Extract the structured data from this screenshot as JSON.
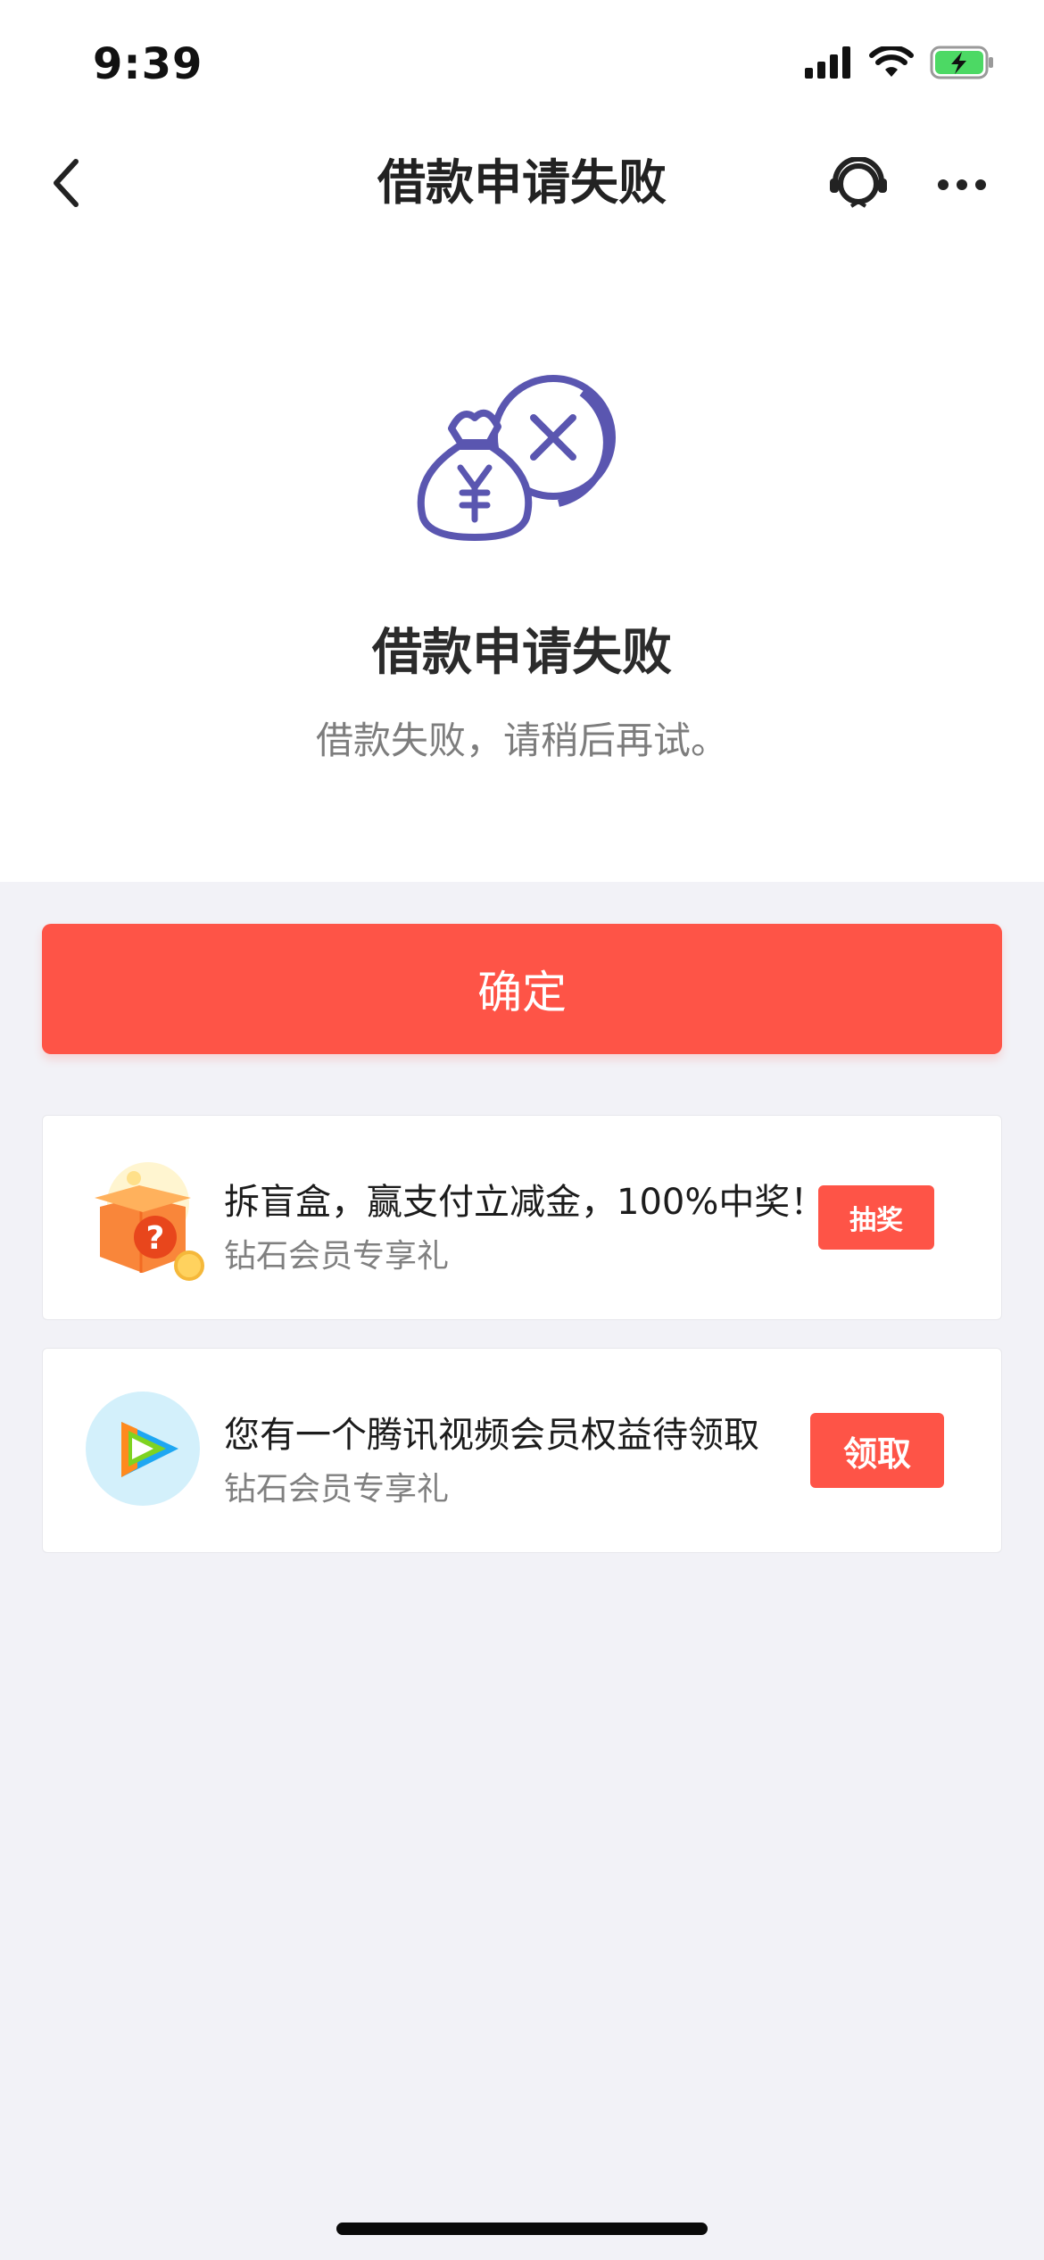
{
  "status_bar": {
    "time": "9:39",
    "icons": [
      "signal-icon",
      "wifi-icon",
      "battery-charging-icon"
    ]
  },
  "nav": {
    "title": "借款申请失败",
    "back_icon": "chevron-left-icon",
    "service_icon": "customer-service-icon",
    "more_icon": "more-icon"
  },
  "result": {
    "icon": "money-bag-failed-icon",
    "title": "借款申请失败",
    "subtitle": "借款失败，请稍后再试。"
  },
  "confirm_button": {
    "label": "确定"
  },
  "promos": [
    {
      "icon": "blind-box-icon",
      "title": "拆盲盒，赢支付立减金，100%中奖！",
      "subtitle": "钻石会员专享礼",
      "button_label": "抽奖"
    },
    {
      "icon": "tencent-video-icon",
      "title": "您有一个腾讯视频会员权益待领取",
      "subtitle": "钻石会员专享礼",
      "button_label": "领取"
    }
  ],
  "colors": {
    "accent": "#fe5447",
    "icon_purple": "#5a56b0",
    "page_bg": "#f2f2f7",
    "battery_green": "#4cd964"
  }
}
